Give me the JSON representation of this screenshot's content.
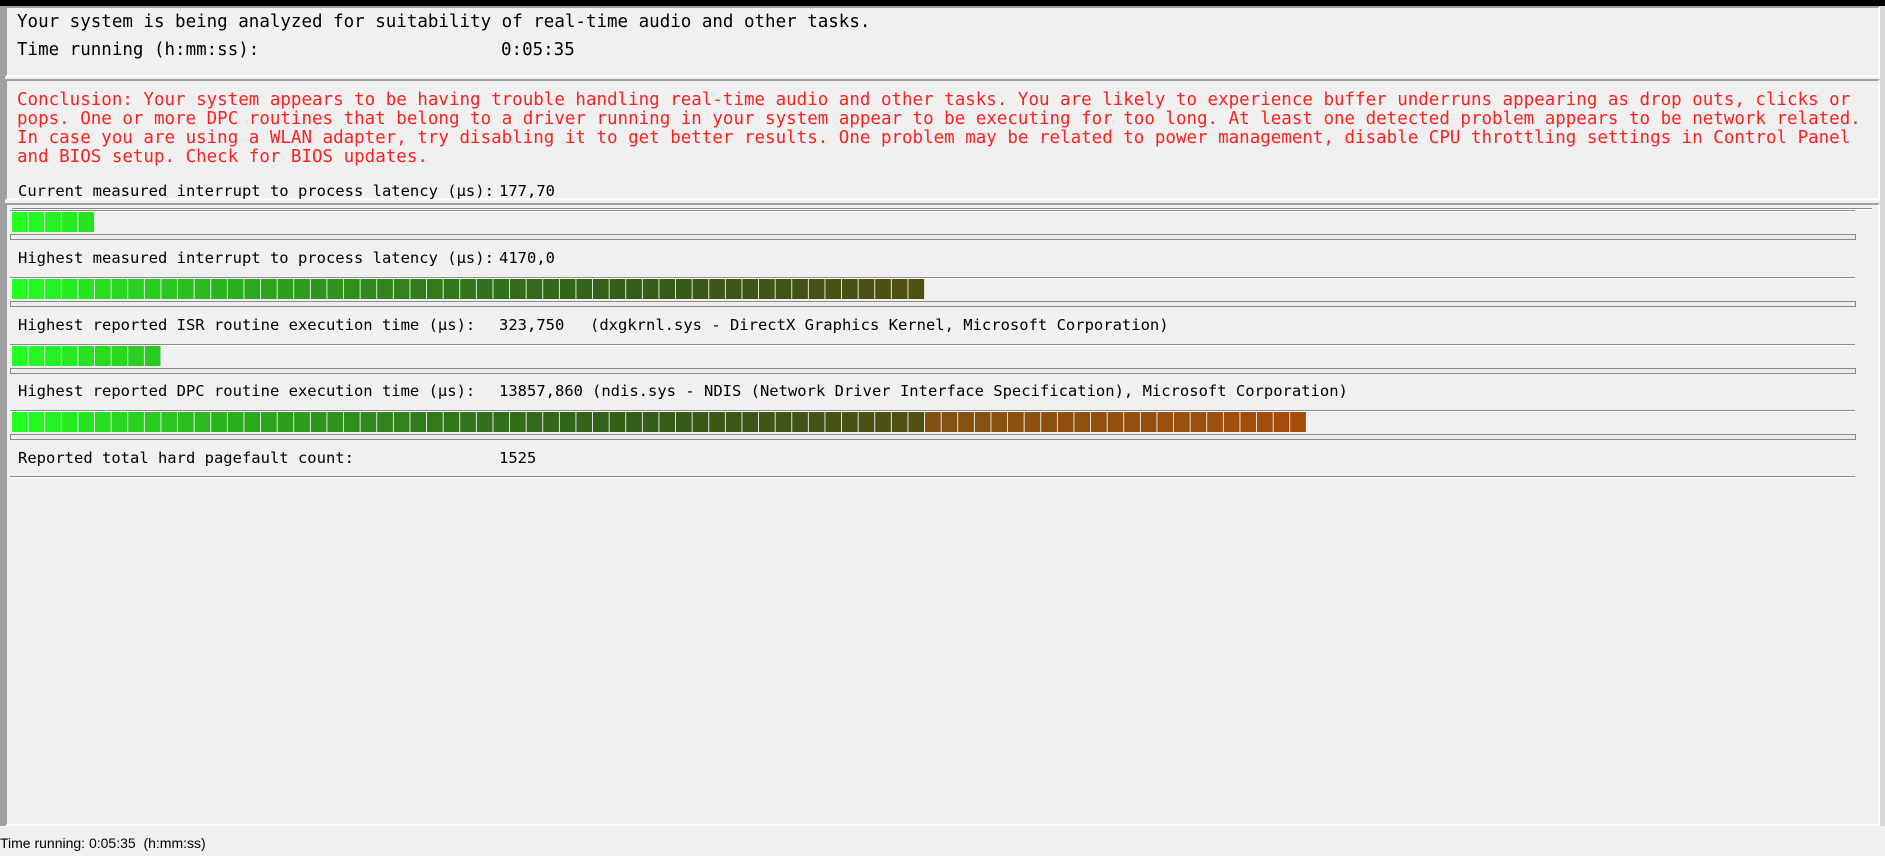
{
  "header": {
    "message": "Your system is being analyzed for suitability of real-time audio and other tasks.",
    "time_label": "Time running (h:mm:ss):",
    "time_value": "0:05:35"
  },
  "conclusion": {
    "text": "Conclusion: Your system appears to be having trouble handling real-time audio and other tasks. You are likely to experience buffer underruns appearing as drop outs, clicks or pops. One or more DPC routines that belong to a driver running in your system appear to be executing for too long. At least one detected problem appears to be network related. In case you are using a WLAN adapter, try disabling it to get better results. One problem may be related to power management, disable CPU throttling settings in Control Panel and BIOS setup. Check for BIOS updates.",
    "color": "#ff1f1f"
  },
  "metrics": [
    {
      "label": "Current measured interrupt to process latency (µs):",
      "value": "177,70",
      "detail": "",
      "bar_segments": 5
    },
    {
      "label": "Highest measured interrupt to process latency (µs):",
      "value": "4170,0",
      "detail": "",
      "bar_segments": 55
    },
    {
      "label": "Highest reported ISR routine execution time (µs):",
      "value": "323,750",
      "detail": "(dxgkrnl.sys - DirectX Graphics Kernel, Microsoft Corporation)",
      "bar_segments": 9
    },
    {
      "label": "Highest reported DPC routine execution time (µs):",
      "value": "13857,860",
      "detail": "(ndis.sys - NDIS (Network Driver Interface Specification), Microsoft Corporation)",
      "bar_segments": 78
    },
    {
      "label": "Reported total hard pagefault count:",
      "value": "1525",
      "detail": "",
      "bar_segments": 0
    }
  ],
  "bar_colors": {
    "start": "#22ff22",
    "end": "#e00000"
  },
  "status_bar": {
    "text": "Time running: 0:05:35  (h:mm:ss)"
  }
}
